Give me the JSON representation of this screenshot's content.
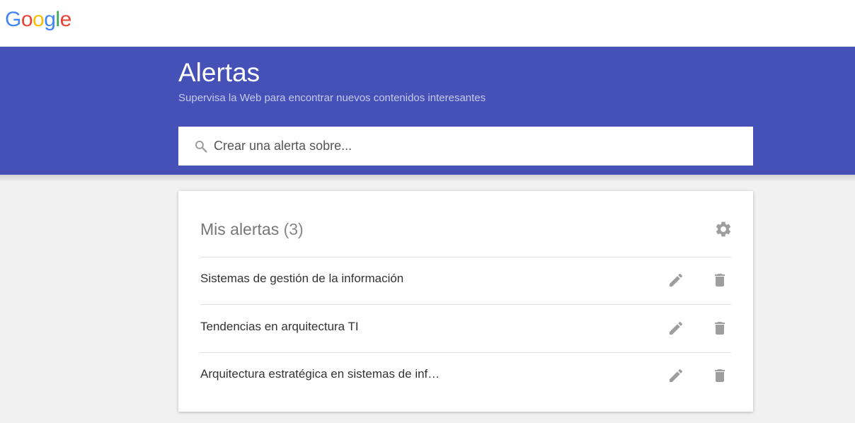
{
  "logo": {
    "letters": [
      "G",
      "o",
      "o",
      "g",
      "l",
      "e"
    ],
    "colors": [
      "#4285F4",
      "#EA4335",
      "#FBBC05",
      "#4285F4",
      "#34A853",
      "#EA4335"
    ]
  },
  "hero": {
    "title": "Alertas",
    "subtitle": "Supervisa la Web para encontrar nuevos contenidos interesantes",
    "background": "#4651b7"
  },
  "search": {
    "placeholder": "Crear una alerta sobre...",
    "value": "",
    "icon": "search-icon"
  },
  "alerts_card": {
    "title": "Mis alertas",
    "count": "(3)",
    "settings_icon": "gear-icon",
    "items": [
      {
        "label": "Sistemas de gestión de la información",
        "edit_icon": "pencil-icon",
        "delete_icon": "trash-icon"
      },
      {
        "label": "Tendencias en arquitectura TI",
        "edit_icon": "pencil-icon",
        "delete_icon": "trash-icon"
      },
      {
        "label": "Arquitectura estratégica en sistemas de inf…",
        "edit_icon": "pencil-icon",
        "delete_icon": "trash-icon"
      }
    ]
  },
  "colors": {
    "icon_gray": "#9e9e9e",
    "page_bg": "#f1f1f1"
  }
}
